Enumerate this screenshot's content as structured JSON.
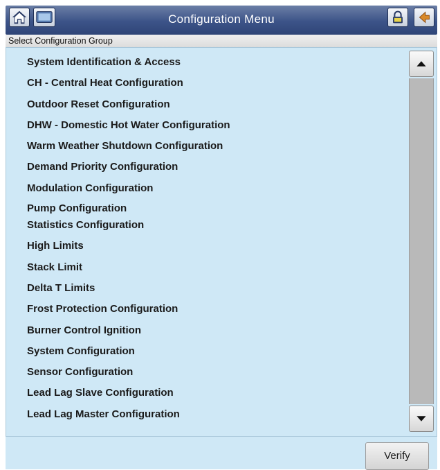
{
  "header": {
    "title": "Configuration Menu",
    "subtitle": "Select Configuration Group",
    "icons": [
      "home-icon",
      "screen-icon",
      "lock-icon",
      "back-arrow-icon"
    ]
  },
  "menu": {
    "items": [
      "System Identification & Access",
      "CH - Central Heat Configuration",
      "Outdoor Reset Configuration",
      "DHW - Domestic Hot Water Configuration",
      "Warm Weather Shutdown Configuration",
      "Demand Priority Configuration",
      "Modulation Configuration",
      "Pump Configuration",
      "Statistics Configuration",
      "High Limits",
      "Stack Limit",
      "Delta T Limits",
      "Frost Protection Configuration",
      "Burner Control Ignition",
      "System Configuration",
      "Sensor Configuration",
      "Lead Lag Slave Configuration",
      "Lead Lag Master Configuration"
    ]
  },
  "footer": {
    "verify_label": "Verify"
  },
  "colors": {
    "title_bar": "#3c5388",
    "panel_background": "#cfe8f6",
    "scrollbar_track": "#b9b9b9"
  }
}
